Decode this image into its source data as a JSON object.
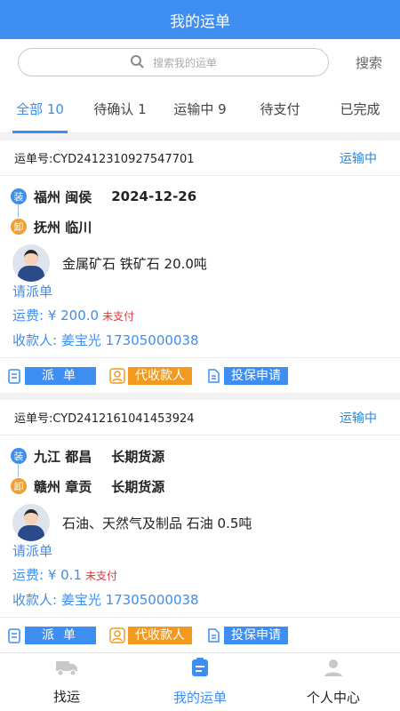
{
  "header": {
    "title": "我的运单"
  },
  "search": {
    "placeholder": "搜索我的运单",
    "button_label": "搜索"
  },
  "tabs": [
    {
      "label": "全部 10"
    },
    {
      "label": "待确认 1"
    },
    {
      "label": "运输中 9"
    },
    {
      "label": "待支付"
    },
    {
      "label": "已完成"
    }
  ],
  "orders": [
    {
      "number": "运单号:CYD2412310927547701",
      "status": "运输中",
      "load_badge": "装",
      "load_place": "福州 闽侯",
      "load_extra": "2024-12-26",
      "unload_badge": "卸",
      "unload_place": "抚州 临川",
      "unload_extra": "",
      "goods": "金属矿石  铁矿石 20.0吨",
      "dispatch_link": "请派单",
      "fee": "运费: ¥ 200.0",
      "fee_status": "未支付",
      "payee": "收款人: 姜宝光  17305000038",
      "btn_dispatch": "派单",
      "btn_collect": "代收款人",
      "btn_insure": "投保申请"
    },
    {
      "number": "运单号:CYD2412161041453924",
      "status": "运输中",
      "load_badge": "装",
      "load_place": "九江 都昌",
      "load_extra": "长期货源",
      "unload_badge": "卸",
      "unload_place": "赣州 章贡",
      "unload_extra": "长期货源",
      "goods": "石油、天然气及制品  石油 0.5吨",
      "dispatch_link": "请派单",
      "fee": "运费: ¥ 0.1",
      "fee_status": "未支付",
      "payee": "收款人: 姜宝光  17305000038",
      "btn_dispatch": "派单",
      "btn_collect": "代收款人",
      "btn_insure": "投保申请"
    }
  ],
  "bottom_nav": [
    {
      "label": "找运",
      "icon": "truck-icon"
    },
    {
      "label": "我的运单",
      "icon": "document-icon"
    },
    {
      "label": "个人中心",
      "icon": "person-icon"
    }
  ],
  "colors": {
    "primary": "#3d8ef0",
    "orange": "#f29a1f",
    "unpaid": "#d83a3a"
  }
}
